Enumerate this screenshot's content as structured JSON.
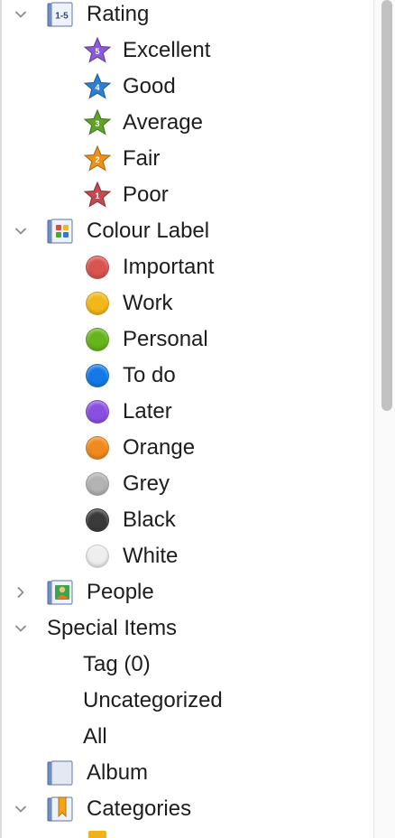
{
  "tree": {
    "rating": {
      "label": "Rating",
      "badge": "1-5",
      "items": [
        {
          "label": "Excellent",
          "value": "5",
          "color": "#8a5bd6"
        },
        {
          "label": "Good",
          "value": "4",
          "color": "#2f7fd0"
        },
        {
          "label": "Average",
          "value": "3",
          "color": "#5fa32a"
        },
        {
          "label": "Fair",
          "value": "2",
          "color": "#e8921b"
        },
        {
          "label": "Poor",
          "value": "1",
          "color": "#c24b52"
        }
      ]
    },
    "colour_label": {
      "label": "Colour Label",
      "items": [
        {
          "label": "Important",
          "color": "#d9534f"
        },
        {
          "label": "Work",
          "color": "#f2b81a"
        },
        {
          "label": "Personal",
          "color": "#67b41c"
        },
        {
          "label": "To do",
          "color": "#1479e6"
        },
        {
          "label": "Later",
          "color": "#8a4fe0"
        },
        {
          "label": "Orange",
          "color": "#f08a1c"
        },
        {
          "label": "Grey",
          "color": "#b3b3b3"
        },
        {
          "label": "Black",
          "color": "#3a3a3a"
        },
        {
          "label": "White",
          "color": "#eeeeee"
        }
      ]
    },
    "people": {
      "label": "People"
    },
    "special_items": {
      "label": "Special Items",
      "items": [
        {
          "label": "Tag (0)"
        },
        {
          "label": "Uncategorized"
        },
        {
          "label": "All"
        }
      ]
    },
    "album": {
      "label": "Album"
    },
    "categories": {
      "label": "Categories"
    }
  }
}
